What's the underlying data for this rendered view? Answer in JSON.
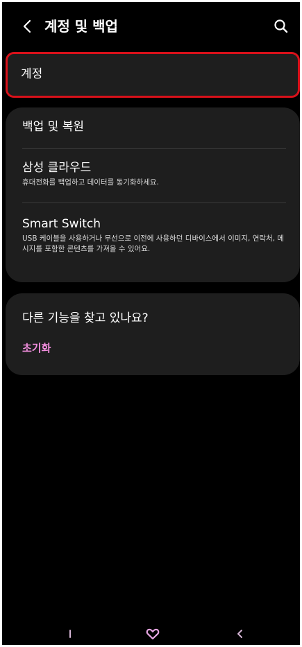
{
  "header": {
    "title": "계정 및 백업",
    "back_icon": "chevron-left-icon",
    "search_icon": "search-icon"
  },
  "account": {
    "label": "계정"
  },
  "backup_section": {
    "items": [
      {
        "title": "백업 및 복원",
        "subtitle": ""
      },
      {
        "title": "삼성 클라우드",
        "subtitle": "휴대전화를 백업하고 데이터를 동기화하세요."
      },
      {
        "title": "Smart Switch",
        "subtitle": "USB 케이블을 사용하거나 무선으로 이전에 사용하던 디바이스에서 이미지, 연락처, 메시지를 포함한 콘텐츠를 가져올 수 있어요."
      }
    ]
  },
  "suggestions": {
    "title": "다른 기능을 찾고 있나요?",
    "link": "초기화"
  },
  "navbar": {
    "recents_icon": "recents-icon",
    "home_icon": "home-heart-icon",
    "back_icon": "back-icon"
  },
  "colors": {
    "background": "#000000",
    "card": "#1e1e1e",
    "highlight": "#d9111a",
    "accent": "#f08ddc"
  }
}
